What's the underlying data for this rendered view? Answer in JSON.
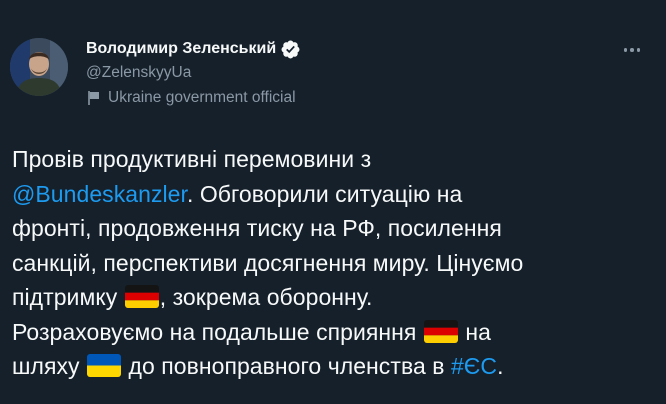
{
  "author": {
    "display_name": "Володимир Зеленський",
    "handle": "@ZelenskyyUa",
    "label": "Ukraine government official",
    "verified": true
  },
  "tweet": {
    "line1": "Провів продуктивні перемовини з",
    "mention": "@Bundeskanzler",
    "line2_rest": ". Обговорили ситуацію на",
    "line3": "фронті, продовження тиску на РФ, посилення",
    "line4": "санкцій, перспективи досягнення миру. Цінуємо",
    "line5_before_flag": "підтримку",
    "line5_after_flag": ", зокрема оборонну.",
    "line6_before_flag": "Розраховуємо на подальше сприяння",
    "line6_after_flag": "на",
    "line7_before_flag": "шляху",
    "line7_after_flag": "до повноправного членства в",
    "hashtag": "#ЄС",
    "line7_end": "."
  },
  "icons": {
    "verified": "verified-badge-icon",
    "label_flag": "government-flag-icon",
    "more": "more-options-icon",
    "flag_de": "germany-flag-emoji",
    "flag_ua": "ukraine-flag-emoji"
  },
  "colors": {
    "background": "#15202b",
    "text": "#f7f9f9",
    "secondary": "#8b98a5",
    "link": "#1d9bf0"
  }
}
